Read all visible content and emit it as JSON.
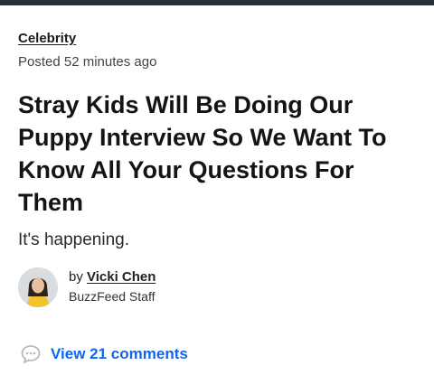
{
  "article": {
    "category": "Celebrity",
    "posted": "Posted 52 minutes ago",
    "headline": "Stray Kids Will Be Doing Our Puppy Interview So We Want To Know All Your Questions For Them",
    "dek": "It's happening."
  },
  "author": {
    "by_prefix": "by",
    "name": "Vicki Chen",
    "role": "BuzzFeed Staff"
  },
  "comments": {
    "label": "View 21 comments",
    "icon": "speech-bubble-icon"
  },
  "colors": {
    "link_blue": "#0f65ef",
    "top_bar": "#2b2f38"
  }
}
